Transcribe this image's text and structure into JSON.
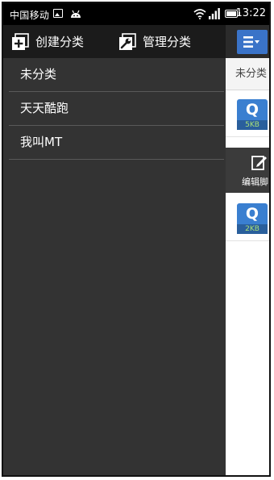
{
  "status_bar": {
    "carrier": "中国移动",
    "time": "13:22"
  },
  "drawer": {
    "create_label": "创建分类",
    "manage_label": "管理分类",
    "categories": [
      "未分类",
      "天天酷跑",
      "我叫MT"
    ]
  },
  "content": {
    "active_tab": "未分类",
    "files": [
      {
        "badge": "Q",
        "size": "5KB"
      },
      {
        "badge": "Q",
        "size": "2KB"
      }
    ],
    "edit_label": "编辑脚"
  }
}
